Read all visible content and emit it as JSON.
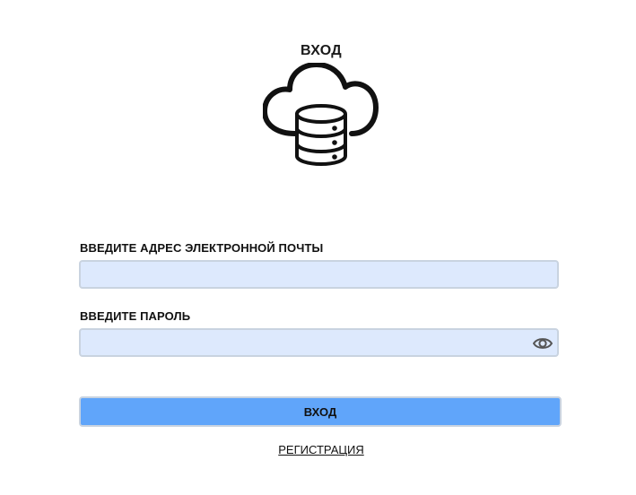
{
  "header": {
    "title": "ВХОД",
    "logo_icon": "cloud-database-icon"
  },
  "form": {
    "email_label": "ВВЕДИТЕ АДРЕС ЭЛЕКТРОННОЙ ПОЧТЫ",
    "email_value": "",
    "password_label": "ВВЕДИТЕ ПАРОЛЬ",
    "password_value": "",
    "password_toggle_icon": "eye-icon",
    "submit_label": "ВХОД",
    "register_label": "РЕГИСТРАЦИЯ"
  },
  "colors": {
    "input_background": "#dde9fd",
    "input_border": "#c9d3e0",
    "button_background": "#60a5fa"
  }
}
